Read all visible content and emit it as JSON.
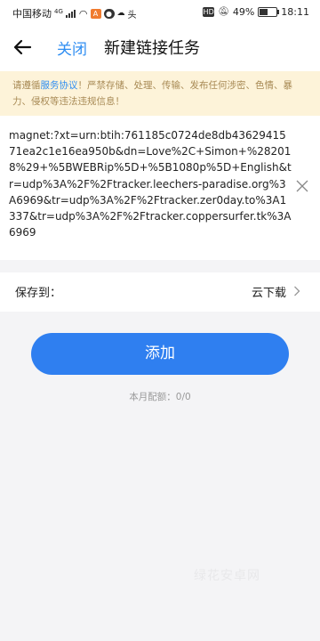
{
  "status_bar": {
    "carrier": "中国移动",
    "network": "4G",
    "battery": "49%",
    "battery_level": 0.49,
    "time": "18:11"
  },
  "header": {
    "back_icon": "arrow-left-icon",
    "close_label": "关闭",
    "title": "新建链接任务"
  },
  "notice": {
    "prefix": "请遵循",
    "link_text": "服务协议",
    "suffix": "！严禁存储、处理、传输、发布任何涉密、色情、暴力、侵权等违法违规信息！"
  },
  "link_input": {
    "value": "magnet:?xt=urn:btih:761185c0724de8db4362941571ea2c1e16ea950b&dn=Love%2C+Simon+%282018%29+%5BWEBRip%5D+%5B1080p%5D+English&tr=udp%3A%2F%2Ftracker.leechers-paradise.org%3A6969&tr=udp%3A%2F%2Ftracker.zer0day.to%3A1337&tr=udp%3A%2F%2Ftracker.coppersurfer.tk%3A6969"
  },
  "save": {
    "label": "保存到：",
    "value": "云下载"
  },
  "add_button": {
    "label": "添加"
  },
  "quota": {
    "text": "本月配额：0/0"
  },
  "watermark": {
    "text": "绿花安卓网"
  },
  "colors": {
    "accent": "#2f7ff0",
    "notice_bg": "#fdf3d9",
    "notice_text": "#a88a55"
  }
}
